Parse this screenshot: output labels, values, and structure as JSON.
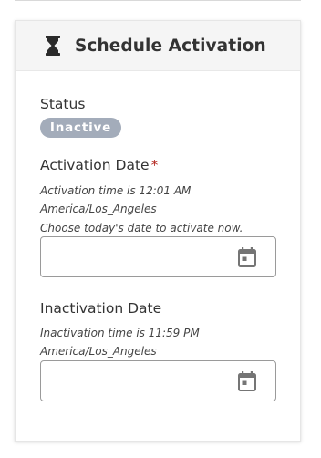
{
  "card": {
    "title": "Schedule Activation",
    "header_icon": "hourglass-icon"
  },
  "status": {
    "label": "Status",
    "badge": "Inactive",
    "badge_color": "#a3acba"
  },
  "activation": {
    "label": "Activation Date",
    "required_marker": "*",
    "help_lines": [
      "Activation time is 12:01 AM",
      "America/Los_Angeles",
      "Choose today's date to activate now."
    ],
    "value": "",
    "calendar_icon": "calendar-icon"
  },
  "inactivation": {
    "label": "Inactivation Date",
    "help_lines": [
      "Inactivation time is 11:59 PM",
      "America/Los_Angeles"
    ],
    "value": "",
    "calendar_icon": "calendar-icon"
  },
  "colors": {
    "required": "#b3261e",
    "header_bg": "#f5f5f5",
    "text": "#333333"
  }
}
